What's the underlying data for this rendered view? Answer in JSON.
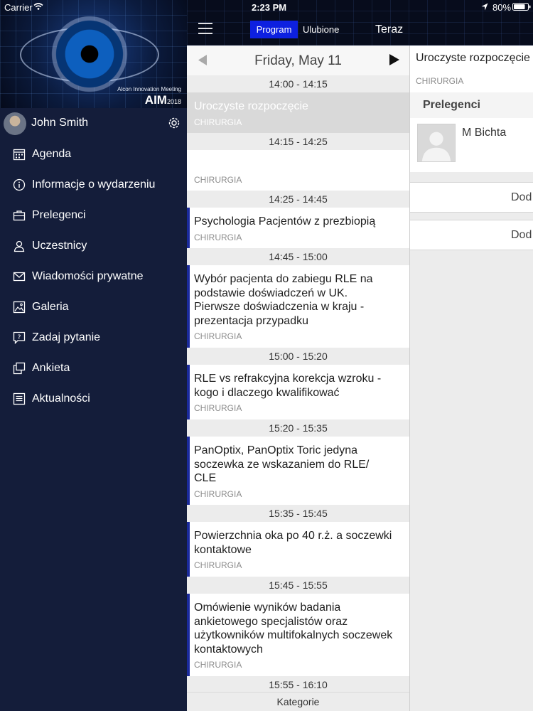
{
  "status_bar": {
    "carrier": "Carrier",
    "time": "2:23 PM",
    "battery": "80%"
  },
  "banner": {
    "subtitle": "Alcon Innovation Meeting",
    "logo": "AIM",
    "year": "2018"
  },
  "user": {
    "name": "John Smith"
  },
  "sidebar": {
    "items": [
      {
        "label": "Agenda",
        "icon": "calendar-icon"
      },
      {
        "label": "Informacje o wydarzeniu",
        "icon": "info-icon"
      },
      {
        "label": "Prelegenci",
        "icon": "briefcase-icon"
      },
      {
        "label": "Uczestnicy",
        "icon": "person-icon"
      },
      {
        "label": "Wiadomości prywatne",
        "icon": "envelope-icon"
      },
      {
        "label": "Galeria",
        "icon": "image-icon"
      },
      {
        "label": "Zadaj pytanie",
        "icon": "question-icon"
      },
      {
        "label": "Ankieta",
        "icon": "survey-icon"
      },
      {
        "label": "Aktualności",
        "icon": "news-icon"
      }
    ]
  },
  "header": {
    "tab_program": "Program",
    "tab_favorites": "Ulubione",
    "now": "Teraz"
  },
  "schedule": {
    "date": "Friday, May 11",
    "slots": [
      {
        "time": "14:00 - 14:15",
        "title": "Uroczyste rozpoczęcie",
        "category": "CHIRURGIA"
      },
      {
        "time": "14:15 - 14:25",
        "title": "",
        "category": "CHIRURGIA"
      },
      {
        "time": "14:25 - 14:45",
        "title": "Psychologia Pacjentów z prezbiopią",
        "category": "CHIRURGIA"
      },
      {
        "time": "14:45 - 15:00",
        "title": "Wybór pacjenta do zabiegu RLE na podstawie doświadczeń w UK. Pierwsze doświadczenia w kraju - prezentacja przypadku",
        "category": "CHIRURGIA"
      },
      {
        "time": "15:00 - 15:20",
        "title": "RLE vs refrakcyjna korekcja wzroku - kogo i dlaczego kwalifikować",
        "category": "CHIRURGIA"
      },
      {
        "time": "15:20 - 15:35",
        "title": "PanOptix, PanOptix Toric jedyna soczewka ze wskazaniem do RLE/ CLE",
        "category": "CHIRURGIA"
      },
      {
        "time": "15:35 - 15:45",
        "title": "Powierzchnia oka po 40 r.ż. a soczewki kontaktowe",
        "category": "CHIRURGIA"
      },
      {
        "time": "15:45 - 15:55",
        "title": "Omówienie wyników badania ankietowego specjalistów oraz użytkowników multifokalnych soczewek kontaktowych",
        "category": "CHIRURGIA"
      },
      {
        "time": "15:55 - 16:10"
      }
    ],
    "categories_label": "Kategorie"
  },
  "detail": {
    "title": "Uroczyste rozpoczęcie",
    "category": "CHIRURGIA",
    "speakers_label": "Prelegenci",
    "speaker_name": "M Bichta",
    "add_label_1": "Dod",
    "add_label_2": "Dod"
  },
  "colors": {
    "sidebar_bg": "#141d3a",
    "accent_tab": "#0d20e0",
    "session_bar": "#1a2a9c"
  }
}
